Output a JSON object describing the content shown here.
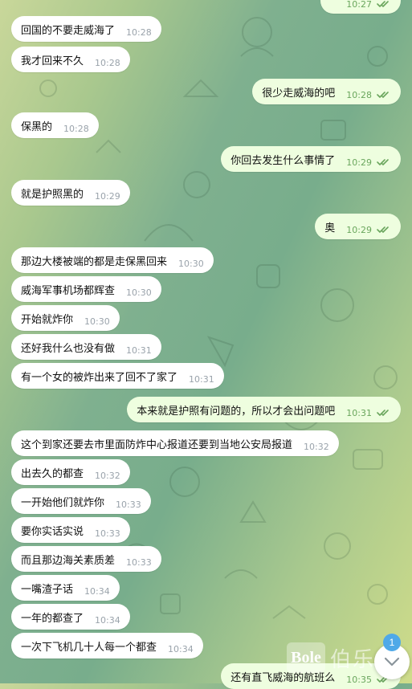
{
  "colors": {
    "incoming_bubble": "#ffffff",
    "outgoing_bubble": "#eefedf",
    "read_ticks": "#6aa65d",
    "badge": "#4fa9e8"
  },
  "messages": [
    {
      "text": "",
      "time": "10:27",
      "dir": "out",
      "read": true
    },
    {
      "text": "回国的不要走威海了",
      "time": "10:28",
      "dir": "in"
    },
    {
      "text": "我才回来不久",
      "time": "10:28",
      "dir": "in"
    },
    {
      "text": "很少走威海的吧",
      "time": "10:28",
      "dir": "out",
      "read": true
    },
    {
      "text": "保黑的",
      "time": "10:28",
      "dir": "in"
    },
    {
      "text": "你回去发生什么事情了",
      "time": "10:29",
      "dir": "out",
      "read": true
    },
    {
      "text": "就是护照黑的",
      "time": "10:29",
      "dir": "in"
    },
    {
      "text": "奥",
      "time": "10:29",
      "dir": "out",
      "read": true
    },
    {
      "text": "那边大楼被端的都是走保黑回来",
      "time": "10:30",
      "dir": "in"
    },
    {
      "text": "威海军事机场都辉查",
      "time": "10:30",
      "dir": "in"
    },
    {
      "text": "开始就炸你",
      "time": "10:30",
      "dir": "in"
    },
    {
      "text": "还好我什么也没有做",
      "time": "10:31",
      "dir": "in"
    },
    {
      "text": "有一个女的被炸出来了回不了家了",
      "time": "10:31",
      "dir": "in"
    },
    {
      "text": "本来就是护照有问题的，所以才会出问题吧",
      "time": "10:31",
      "dir": "out",
      "read": true
    },
    {
      "text": "这个到家还要去市里面防炸中心报道还要到当地公安局报道",
      "time": "10:32",
      "dir": "in"
    },
    {
      "text": "出去久的都查",
      "time": "10:32",
      "dir": "in"
    },
    {
      "text": "一开始他们就炸你",
      "time": "10:33",
      "dir": "in"
    },
    {
      "text": "要你实话实说",
      "time": "10:33",
      "dir": "in"
    },
    {
      "text": "而且那边海关素质差",
      "time": "10:33",
      "dir": "in"
    },
    {
      "text": "一嘴渣子话",
      "time": "10:34",
      "dir": "in"
    },
    {
      "text": "一年的都查了",
      "time": "10:34",
      "dir": "in"
    },
    {
      "text": "一次下飞机几十人每一个都查",
      "time": "10:34",
      "dir": "in"
    },
    {
      "text": "还有直飞威海的航班么",
      "time": "10:35",
      "dir": "out",
      "read": true
    }
  ],
  "scroll_button": {
    "icon": "chevron-down-icon",
    "badge": "1"
  },
  "watermark": {
    "logo_text": "Bole",
    "text": "伯乐"
  }
}
